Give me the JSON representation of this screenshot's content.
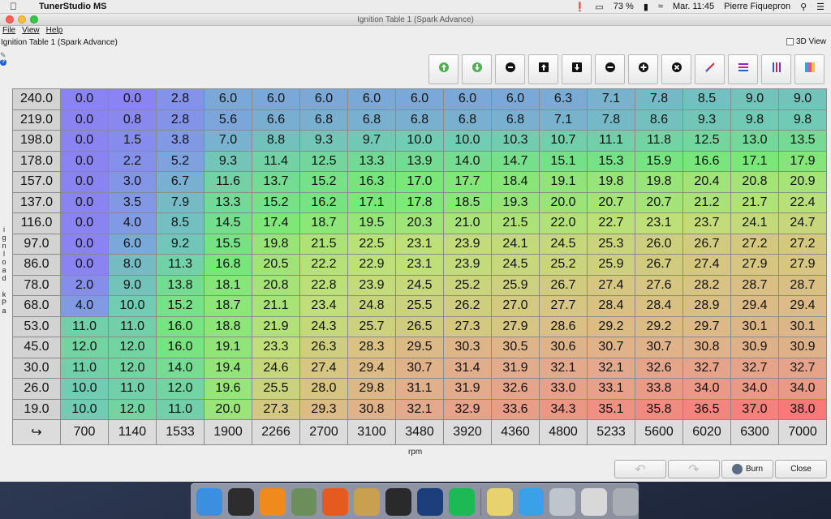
{
  "menubar": {
    "app_name": "TunerStudio MS",
    "battery": "73 %",
    "clock": "Mar. 11:45",
    "user": "Pierre Fiquepron"
  },
  "window": {
    "title": "Ignition Table 1 (Spark Advance)",
    "menus": [
      "File",
      "View",
      "Help"
    ],
    "panel_title": "Ignition Table 1 (Spark Advance)",
    "view3d_label": "3D View"
  },
  "toolbar": {
    "buttons": [
      {
        "icon": "up-arrow-icon",
        "color": "#4caf50"
      },
      {
        "icon": "down-arrow-icon",
        "color": "#4caf50"
      },
      {
        "icon": "minus-icon",
        "color": "#111111"
      },
      {
        "icon": "arrow-up-box-icon",
        "color": "#111111"
      },
      {
        "icon": "arrow-down-box-icon",
        "color": "#111111"
      },
      {
        "icon": "decrease-icon",
        "color": "#111111"
      },
      {
        "icon": "increase-icon",
        "color": "#111111"
      },
      {
        "icon": "clear-icon",
        "color": "#111111"
      },
      {
        "icon": "interpolate-icon",
        "color": "#d9264a"
      },
      {
        "icon": "horizontal-smooth-icon",
        "color": "#7a2fd1"
      },
      {
        "icon": "vertical-smooth-icon",
        "color": "#c0265a"
      },
      {
        "icon": "color-map-icon",
        "color": "#2aa9d9"
      }
    ]
  },
  "table": {
    "y_axis_label": "ignload kPa",
    "x_axis_label": "rpm",
    "rpm": [
      "700",
      "1140",
      "1533",
      "1900",
      "2266",
      "2700",
      "3100",
      "3480",
      "3920",
      "4360",
      "4800",
      "5233",
      "5600",
      "6020",
      "6300",
      "7000"
    ],
    "load": [
      "240.0",
      "219.0",
      "198.0",
      "178.0",
      "157.0",
      "137.0",
      "116.0",
      "97.0",
      "86.0",
      "78.0",
      "68.0",
      "53.0",
      "45.0",
      "30.0",
      "26.0",
      "19.0"
    ],
    "values": [
      [
        "0.0",
        "0.0",
        "2.8",
        "6.0",
        "6.0",
        "6.0",
        "6.0",
        "6.0",
        "6.0",
        "6.0",
        "6.3",
        "7.1",
        "7.8",
        "8.5",
        "9.0",
        "9.0"
      ],
      [
        "0.0",
        "0.8",
        "2.8",
        "5.6",
        "6.6",
        "6.8",
        "6.8",
        "6.8",
        "6.8",
        "6.8",
        "7.1",
        "7.8",
        "8.6",
        "9.3",
        "9.8",
        "9.8"
      ],
      [
        "0.0",
        "1.5",
        "3.8",
        "7.0",
        "8.8",
        "9.3",
        "9.7",
        "10.0",
        "10.0",
        "10.3",
        "10.7",
        "11.1",
        "11.8",
        "12.5",
        "13.0",
        "13.5"
      ],
      [
        "0.0",
        "2.2",
        "5.2",
        "9.3",
        "11.4",
        "12.5",
        "13.3",
        "13.9",
        "14.0",
        "14.7",
        "15.1",
        "15.3",
        "15.9",
        "16.6",
        "17.1",
        "17.9"
      ],
      [
        "0.0",
        "3.0",
        "6.7",
        "11.6",
        "13.7",
        "15.2",
        "16.3",
        "17.0",
        "17.7",
        "18.4",
        "19.1",
        "19.8",
        "19.8",
        "20.4",
        "20.8",
        "20.9"
      ],
      [
        "0.0",
        "3.5",
        "7.9",
        "13.3",
        "15.2",
        "16.2",
        "17.1",
        "17.8",
        "18.5",
        "19.3",
        "20.0",
        "20.7",
        "20.7",
        "21.2",
        "21.7",
        "22.4"
      ],
      [
        "0.0",
        "4.0",
        "8.5",
        "14.5",
        "17.4",
        "18.7",
        "19.5",
        "20.3",
        "21.0",
        "21.5",
        "22.0",
        "22.7",
        "23.1",
        "23.7",
        "24.1",
        "24.7"
      ],
      [
        "0.0",
        "6.0",
        "9.2",
        "15.5",
        "19.8",
        "21.5",
        "22.5",
        "23.1",
        "23.9",
        "24.1",
        "24.5",
        "25.3",
        "26.0",
        "26.7",
        "27.2",
        "27.2"
      ],
      [
        "0.0",
        "8.0",
        "11.3",
        "16.8",
        "20.5",
        "22.2",
        "22.9",
        "23.1",
        "23.9",
        "24.5",
        "25.2",
        "25.9",
        "26.7",
        "27.4",
        "27.9",
        "27.9"
      ],
      [
        "2.0",
        "9.0",
        "13.8",
        "18.1",
        "20.8",
        "22.8",
        "23.9",
        "24.5",
        "25.2",
        "25.9",
        "26.7",
        "27.4",
        "27.6",
        "28.2",
        "28.7",
        "28.7"
      ],
      [
        "4.0",
        "10.0",
        "15.2",
        "18.7",
        "21.1",
        "23.4",
        "24.8",
        "25.5",
        "26.2",
        "27.0",
        "27.7",
        "28.4",
        "28.4",
        "28.9",
        "29.4",
        "29.4"
      ],
      [
        "11.0",
        "11.0",
        "16.0",
        "18.8",
        "21.9",
        "24.3",
        "25.7",
        "26.5",
        "27.3",
        "27.9",
        "28.6",
        "29.2",
        "29.2",
        "29.7",
        "30.1",
        "30.1"
      ],
      [
        "12.0",
        "12.0",
        "16.0",
        "19.1",
        "23.3",
        "26.3",
        "28.3",
        "29.5",
        "30.3",
        "30.5",
        "30.6",
        "30.7",
        "30.7",
        "30.8",
        "30.9",
        "30.9"
      ],
      [
        "11.0",
        "12.0",
        "14.0",
        "19.4",
        "24.6",
        "27.4",
        "29.4",
        "30.7",
        "31.4",
        "31.9",
        "32.1",
        "32.1",
        "32.6",
        "32.7",
        "32.7",
        "32.7"
      ],
      [
        "10.0",
        "11.0",
        "12.0",
        "19.6",
        "25.5",
        "28.0",
        "29.8",
        "31.1",
        "31.9",
        "32.6",
        "33.0",
        "33.1",
        "33.8",
        "34.0",
        "34.0",
        "34.0"
      ],
      [
        "10.0",
        "12.0",
        "11.0",
        "20.0",
        "27.3",
        "29.3",
        "30.8",
        "32.1",
        "32.9",
        "33.6",
        "34.3",
        "35.1",
        "35.8",
        "36.5",
        "37.0",
        "38.0"
      ]
    ]
  },
  "buttons": {
    "burn": "Burn",
    "close": "Close"
  },
  "dock": {
    "icons": [
      "finder-icon",
      "dashboard-icon",
      "vlc-icon",
      "preview-icon",
      "firefox-icon",
      "photos-icon",
      "activity-monitor-icon",
      "efi-analytics-icon",
      "spotify-icon",
      "stickies-icon",
      "downloads-folder-icon",
      "files-icon",
      "mail-icon",
      "trash-icon"
    ]
  }
}
